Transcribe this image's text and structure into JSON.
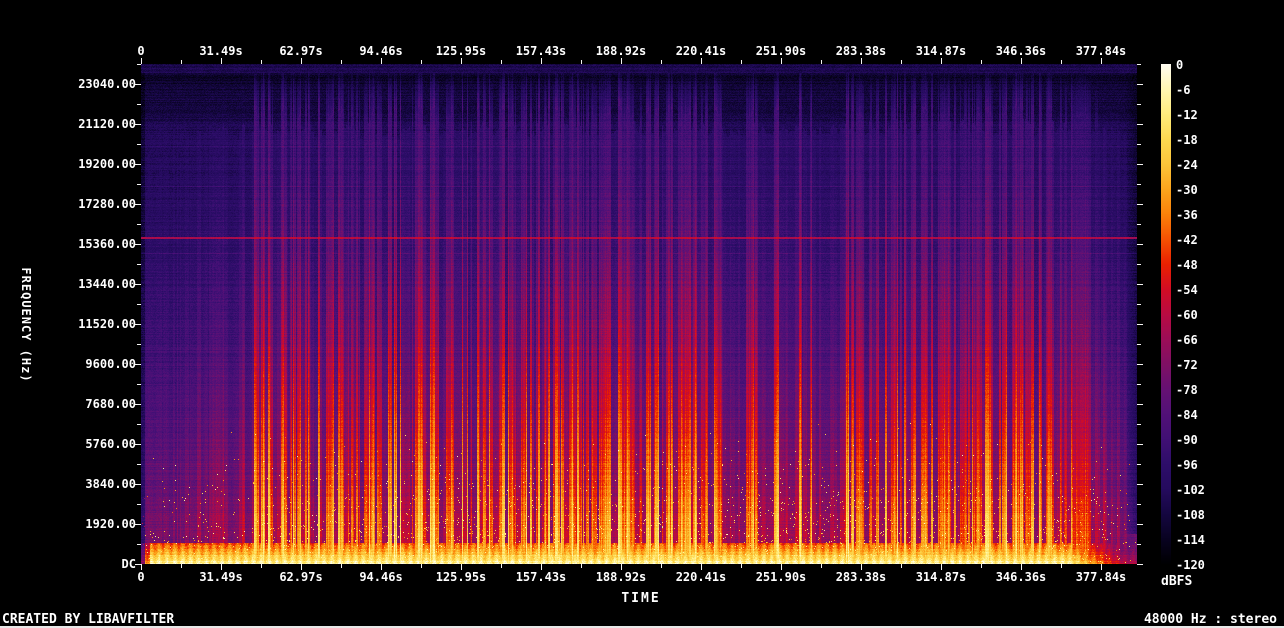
{
  "chart_data": {
    "type": "heatmap",
    "subtype": "audio-spectrogram",
    "xlabel": "TIME",
    "ylabel": "FREQUENCY (Hz)",
    "x_ticks": [
      "0",
      "31.49s",
      "62.97s",
      "94.46s",
      "125.95s",
      "157.43s",
      "188.92s",
      "220.41s",
      "251.90s",
      "283.38s",
      "314.87s",
      "346.36s",
      "377.84s"
    ],
    "x_tick_interval_seconds": 31.49,
    "x_range_seconds": [
      0,
      392
    ],
    "y_ticks": [
      "23040.00",
      "21120.00",
      "19200.00",
      "17280.00",
      "15360.00",
      "13440.00",
      "11520.00",
      "9600.00",
      "7680.00",
      "5760.00",
      "3840.00",
      "1920.00",
      "DC"
    ],
    "y_range_hz": [
      0,
      24000
    ],
    "legend": {
      "label": "dBFS",
      "ticks": [
        "0",
        "-6",
        "-12",
        "-18",
        "-24",
        "-30",
        "-36",
        "-42",
        "-48",
        "-54",
        "-60",
        "-66",
        "-72",
        "-78",
        "-84",
        "-90",
        "-96",
        "-102",
        "-108",
        "-114",
        "-120"
      ],
      "range_db": [
        0,
        -120
      ]
    },
    "colormap_stops": [
      [
        0.0,
        "#000002"
      ],
      [
        0.05,
        "#090322"
      ],
      [
        0.1,
        "#150741"
      ],
      [
        0.15,
        "#250b5e"
      ],
      [
        0.2,
        "#2e0e6a"
      ],
      [
        0.25,
        "#411075"
      ],
      [
        0.3,
        "#521178"
      ],
      [
        0.35,
        "#661173"
      ],
      [
        0.4,
        "#801064"
      ],
      [
        0.45,
        "#9c0d57"
      ],
      [
        0.5,
        "#b90b42"
      ],
      [
        0.55,
        "#d30d24"
      ],
      [
        0.6,
        "#ea2101"
      ],
      [
        0.65,
        "#f65203"
      ],
      [
        0.7,
        "#fb820a"
      ],
      [
        0.75,
        "#fca51d"
      ],
      [
        0.8,
        "#fdc53a"
      ],
      [
        0.85,
        "#fed951"
      ],
      [
        0.9,
        "#ffec7d"
      ],
      [
        0.95,
        "#fff7b2"
      ],
      [
        1.0,
        "#fffdf2"
      ]
    ],
    "render": {
      "tone_line_y": 237,
      "tone_line_hz": 15500,
      "faint_line_ys": [
        146,
        186,
        253
      ],
      "activity_start_x": 252,
      "fade_start_x": 1058,
      "haze_ceiling_hz": 21000
    },
    "footer_left": "CREATED BY LIBAVFILTER",
    "footer_right": "48000 Hz : stereo"
  }
}
